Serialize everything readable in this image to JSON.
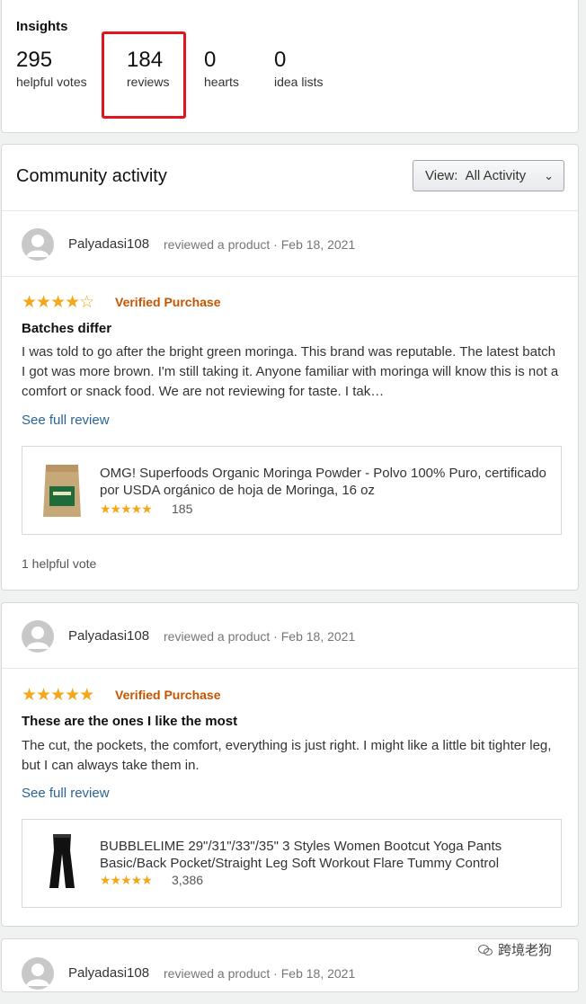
{
  "insights": {
    "title": "Insights",
    "stats": [
      {
        "value": "295",
        "label": "helpful votes"
      },
      {
        "value": "184",
        "label": "reviews"
      },
      {
        "value": "0",
        "label": "hearts"
      },
      {
        "value": "0",
        "label": "idea lists"
      }
    ],
    "highlight_color": "#e3141c"
  },
  "community": {
    "title": "Community activity",
    "view_label": "View:",
    "view_value": "All Activity"
  },
  "reviews": [
    {
      "user": "Palyadasi108",
      "action": "reviewed a product · Feb 18, 2021",
      "rating": 4,
      "verified": "Verified Purchase",
      "title": "Batches differ",
      "body": "I was told to go after the bright green moringa. This brand was reputable. The latest batch I got was more brown. I'm still taking it. Anyone familiar with moringa will know this is not a comfort or snack food. We are not reviewing for taste. I tak…",
      "see_full": "See full review",
      "product": {
        "title": "OMG! Superfoods Organic Moringa Powder - Polvo 100% Puro, certificado por USDA orgánico de hoja de Moringa, 16 oz",
        "rating": 4.5,
        "count": "185"
      },
      "helpful": "1 helpful vote"
    },
    {
      "user": "Palyadasi108",
      "action": "reviewed a product · Feb 18, 2021",
      "rating": 5,
      "verified": "Verified Purchase",
      "title": "These are the ones I like the most",
      "body": "The cut, the pockets, the comfort, everything is just right. I might like a little bit tighter leg, but I can always take them in.",
      "see_full": "See full review",
      "product": {
        "title": "BUBBLELIME 29\"/31\"/33\"/35\" 3 Styles Women Bootcut Yoga Pants Basic/Back Pocket/Straight Leg Soft Workout Flare Tummy Control",
        "rating": 4.5,
        "count": "3,386"
      }
    },
    {
      "user": "Palyadasi108",
      "action": "reviewed a product · Feb 18, 2021"
    }
  ],
  "watermark": "跨境老狗",
  "colors": {
    "star": "#f4a71a",
    "verified": "#c45500",
    "link": "#2a6496"
  }
}
